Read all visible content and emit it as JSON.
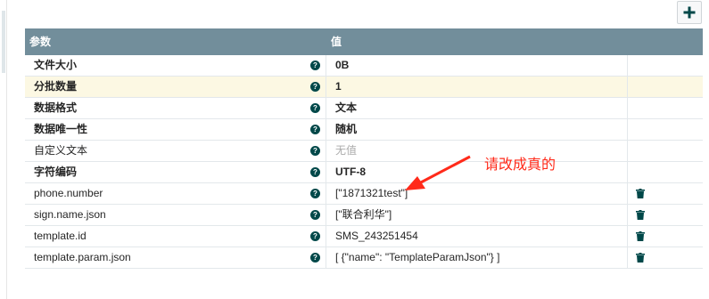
{
  "header": {
    "col_param": "参数",
    "col_value": "值"
  },
  "add_button": {
    "icon": "plus-icon"
  },
  "rows": [
    {
      "name": "文件大小",
      "value": "0B",
      "bold": true,
      "highlight": false,
      "deletable": false,
      "empty": false
    },
    {
      "name": "分批数量",
      "value": "1",
      "bold": true,
      "highlight": true,
      "deletable": false,
      "empty": false
    },
    {
      "name": "数据格式",
      "value": "文本",
      "bold": true,
      "highlight": false,
      "deletable": false,
      "empty": false
    },
    {
      "name": "数据唯一性",
      "value": "随机",
      "bold": true,
      "highlight": false,
      "deletable": false,
      "empty": false
    },
    {
      "name": "自定义文本",
      "value": "无值",
      "bold": false,
      "highlight": false,
      "deletable": false,
      "empty": true
    },
    {
      "name": "字符编码",
      "value": "UTF-8",
      "bold": true,
      "highlight": false,
      "deletable": false,
      "empty": false
    },
    {
      "name": "phone.number",
      "value": "[\"1871321test\"]",
      "bold": false,
      "highlight": false,
      "deletable": true,
      "empty": false
    },
    {
      "name": "sign.name.json",
      "value": "[\"联合利华\"]",
      "bold": false,
      "highlight": false,
      "deletable": true,
      "empty": false
    },
    {
      "name": "template.id",
      "value": "SMS_243251454",
      "bold": false,
      "highlight": false,
      "deletable": true,
      "empty": false
    },
    {
      "name": "template.param.json",
      "value": "[ {\"name\": \"TemplateParamJson\"} ]",
      "bold": false,
      "highlight": false,
      "deletable": true,
      "empty": false
    }
  ],
  "annotation": {
    "text": "请改成真的",
    "color": "#ff2a1a"
  },
  "colors": {
    "header_bg": "#728e9b",
    "highlight_bg": "#fcf8e3",
    "help_icon": "#004849",
    "trash_icon": "#004849"
  }
}
